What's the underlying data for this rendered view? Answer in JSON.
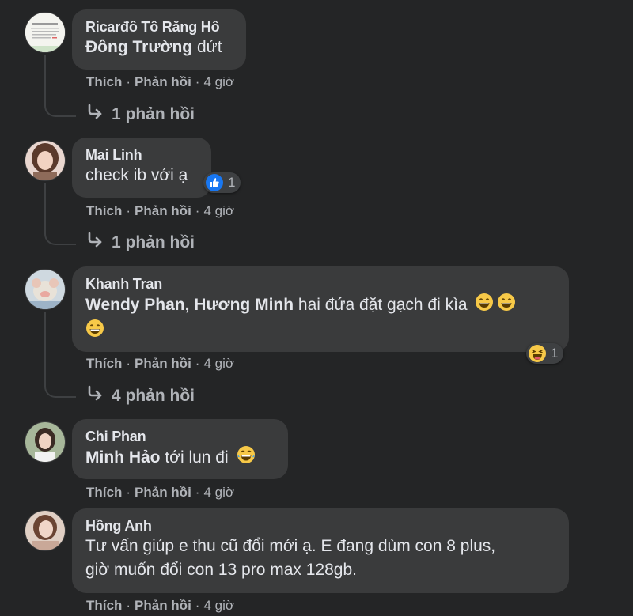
{
  "comments": [
    {
      "author": "Ricarđô Tô Răng Hô",
      "text_bold": "Đông Trường",
      "text_rest": " dứt",
      "actions": {
        "like": "Thích",
        "reply": "Phản hồi",
        "time": "4 giờ"
      },
      "reply_link": "1 phản hồi"
    },
    {
      "author": "Mai Linh",
      "text": "check ib với ạ",
      "reaction": {
        "icon": "like-icon",
        "count": "1"
      },
      "actions": {
        "like": "Thích",
        "reply": "Phản hồi",
        "time": "4 giờ"
      },
      "reply_link": "1 phản hồi"
    },
    {
      "author": "Khanh Tran",
      "text_bold": "Wendy Phan, Hương Minh",
      "text_rest": " hai đứa đặt gạch đi kìa",
      "reaction": {
        "icon": "laugh-icon",
        "count": "1"
      },
      "actions": {
        "like": "Thích",
        "reply": "Phản hồi",
        "time": "4 giờ"
      },
      "reply_link": "4 phản hồi"
    },
    {
      "author": "Chi Phan",
      "text_bold": "Minh Hảo",
      "text_rest": " tới lun đi",
      "actions": {
        "like": "Thích",
        "reply": "Phản hồi",
        "time": "4 giờ"
      }
    },
    {
      "author": "Hồng Anh",
      "text_line1": "Tư vấn giúp e thu cũ đổi mới ạ. E đang dùm con 8 plus,",
      "text_line2": "giờ muốn đổi con 13 pro max 128gb.",
      "actions": {
        "like": "Thích",
        "reply": "Phản hồi",
        "time": "4 giờ"
      }
    }
  ],
  "colors": {
    "background": "#242526",
    "bubble": "#3a3b3c",
    "text": "#e4e6eb",
    "muted": "#b0b3b8",
    "like_blue": "#1877f2",
    "emoji_yellow": "#f7c948"
  }
}
